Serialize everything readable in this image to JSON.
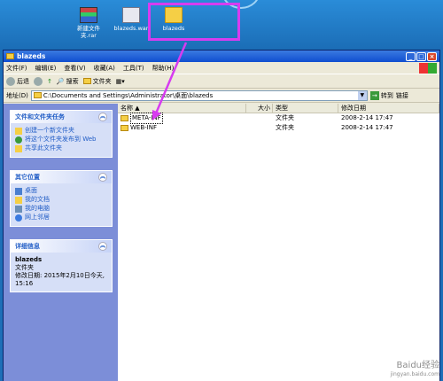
{
  "desktop": {
    "icons": [
      {
        "label": "新建文件夹.rar",
        "icon": "rar-archive-icon"
      },
      {
        "label": "blazeds.war",
        "icon": "war-file-icon"
      },
      {
        "label": "blazeds",
        "icon": "folder-icon"
      }
    ],
    "highlight_color": "#d73cf0"
  },
  "window": {
    "title": "blazeds",
    "menu": [
      "文件(F)",
      "编辑(E)",
      "查看(V)",
      "收藏(A)",
      "工具(T)",
      "帮助(H)"
    ],
    "toolbar": {
      "back": "后退",
      "search": "搜索",
      "folders": "文件夹"
    },
    "address": {
      "label": "地址(D)",
      "path": "C:\\Documents and Settings\\Administrator\\桌面\\blazeds",
      "go": "转到",
      "links": "链接"
    }
  },
  "tasks": {
    "file_tasks": {
      "title": "文件和文件夹任务",
      "items": [
        "创建一个新文件夹",
        "将这个文件夹发布到 Web",
        "共享此文件夹"
      ]
    },
    "other_places": {
      "title": "其它位置",
      "items": [
        "桌面",
        "我的文档",
        "我的电脑",
        "网上邻居"
      ]
    },
    "details": {
      "title": "详细信息",
      "name": "blazeds",
      "type": "文件夹",
      "modified": "修改日期: 2015年2月10日今天, 15:16"
    }
  },
  "files": {
    "columns": [
      "名称",
      "大小",
      "类型",
      "修改日期"
    ],
    "rows": [
      {
        "name": "META-INF",
        "size": "",
        "type": "文件夹",
        "date": "2008-2-14 17:47"
      },
      {
        "name": "WEB-INF",
        "size": "",
        "type": "文件夹",
        "date": "2008-2-14 17:47"
      }
    ]
  },
  "watermark": {
    "text": "Baidu经验",
    "url": "jingyan.baidu.com"
  }
}
